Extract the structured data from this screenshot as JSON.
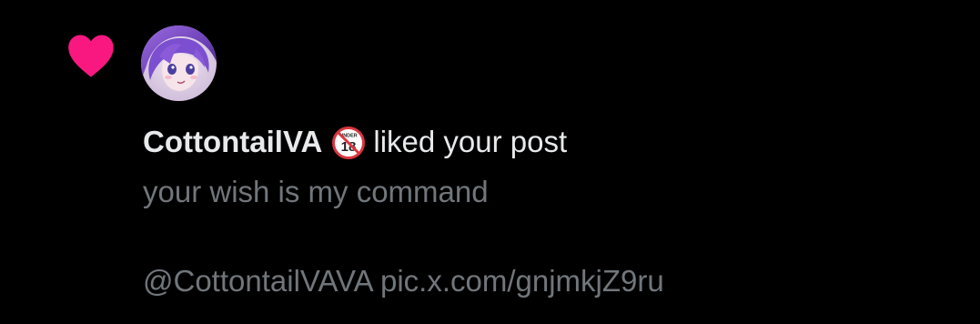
{
  "notification": {
    "type_icon": "heart-icon",
    "accent_color": "#f91880",
    "user": {
      "display_name": "CottontailVA",
      "badge_icon": "no-under-18-icon",
      "badge_text": "UNDER",
      "badge_number": "18"
    },
    "action_text": "liked your post",
    "post": {
      "text": "your wish is my command",
      "mention": "@CottontailVAVA",
      "link": "pic.x.com/gnjmkjZ9ru"
    }
  },
  "colors": {
    "background": "#000000",
    "primary_text": "#e7e9ea",
    "secondary_text": "#71767b"
  }
}
